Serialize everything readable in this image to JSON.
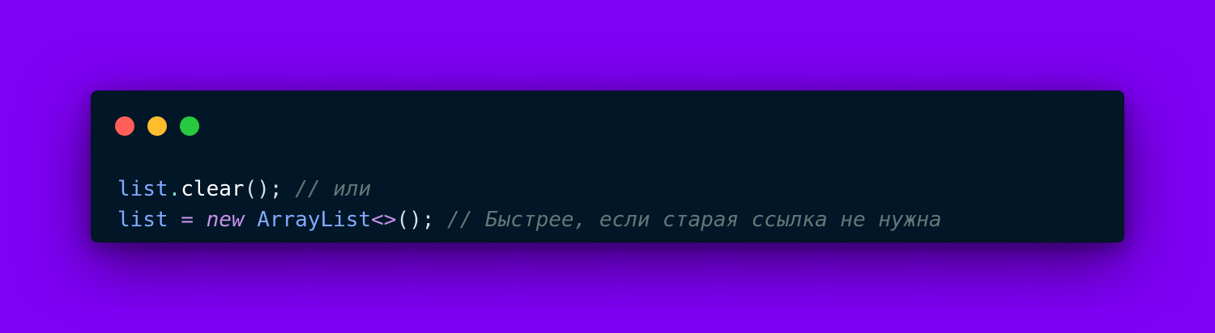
{
  "window": {
    "background": "#011627",
    "controls": [
      {
        "name": "close-dot",
        "color": "#ff5f56"
      },
      {
        "name": "minimize-dot",
        "color": "#ffbd2e"
      },
      {
        "name": "maximize-dot",
        "color": "#27c93f"
      }
    ]
  },
  "page_background": "#7f00f5",
  "code": {
    "line1": {
      "var": "list",
      "dot": ".",
      "method": "clear",
      "parens": "()",
      "semi": ";",
      "comment": "// или"
    },
    "line2": {
      "var": "list",
      "assign": "=",
      "keyword": "new",
      "class": "ArrayList",
      "generics": "<>",
      "parens": "()",
      "semi": ";",
      "comment": "// Быстрее, если старая ссылка не нужна"
    }
  }
}
